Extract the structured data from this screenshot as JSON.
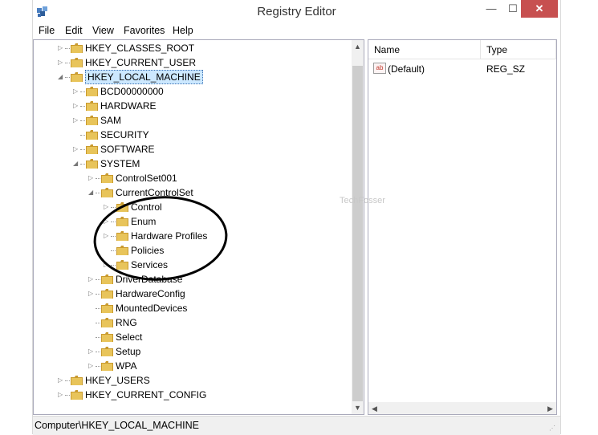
{
  "window": {
    "title": "Registry Editor",
    "minimize": "—",
    "maximize": "☐",
    "close": "✕"
  },
  "menu": [
    "File",
    "Edit",
    "View",
    "Favorites",
    "Help"
  ],
  "tree": {
    "nodes": [
      {
        "label": "HKEY_CLASSES_ROOT",
        "level": 0,
        "expander": "▷"
      },
      {
        "label": "HKEY_CURRENT_USER",
        "level": 0,
        "expander": "▷"
      },
      {
        "label": "HKEY_LOCAL_MACHINE",
        "level": 0,
        "expander": "◢",
        "selected": true
      },
      {
        "label": "BCD00000000",
        "level": 1,
        "expander": "▷"
      },
      {
        "label": "HARDWARE",
        "level": 1,
        "expander": "▷"
      },
      {
        "label": "SAM",
        "level": 1,
        "expander": "▷"
      },
      {
        "label": "SECURITY",
        "level": 1,
        "expander": ""
      },
      {
        "label": "SOFTWARE",
        "level": 1,
        "expander": "▷"
      },
      {
        "label": "SYSTEM",
        "level": 1,
        "expander": "◢"
      },
      {
        "label": "ControlSet001",
        "level": 2,
        "expander": "▷"
      },
      {
        "label": "CurrentControlSet",
        "level": 2,
        "expander": "◢"
      },
      {
        "label": "Control",
        "level": 3,
        "expander": "▷"
      },
      {
        "label": "Enum",
        "level": 3,
        "expander": "▷"
      },
      {
        "label": "Hardware Profiles",
        "level": 3,
        "expander": "▷"
      },
      {
        "label": "Policies",
        "level": 3,
        "expander": ""
      },
      {
        "label": "Services",
        "level": 3,
        "expander": "▷"
      },
      {
        "label": "DriverDatabase",
        "level": 2,
        "expander": "▷"
      },
      {
        "label": "HardwareConfig",
        "level": 2,
        "expander": "▷"
      },
      {
        "label": "MountedDevices",
        "level": 2,
        "expander": ""
      },
      {
        "label": "RNG",
        "level": 2,
        "expander": ""
      },
      {
        "label": "Select",
        "level": 2,
        "expander": ""
      },
      {
        "label": "Setup",
        "level": 2,
        "expander": "▷"
      },
      {
        "label": "WPA",
        "level": 2,
        "expander": "▷"
      },
      {
        "label": "HKEY_USERS",
        "level": 0,
        "expander": "▷"
      },
      {
        "label": "HKEY_CURRENT_CONFIG",
        "level": 0,
        "expander": "▷"
      }
    ]
  },
  "list": {
    "columns": [
      "Name",
      "Type"
    ],
    "rows": [
      {
        "name": "(Default)",
        "type": "REG_SZ",
        "icon": "string-value-icon"
      }
    ]
  },
  "status": {
    "path": "Computer\\HKEY_LOCAL_MACHINE"
  },
  "watermark": "TechFosser",
  "colors": {
    "folder": "#e8c45a",
    "folder_dark": "#c99a2e",
    "selection": "#cce8ff",
    "close": "#c75050",
    "annotation": "#000000"
  }
}
